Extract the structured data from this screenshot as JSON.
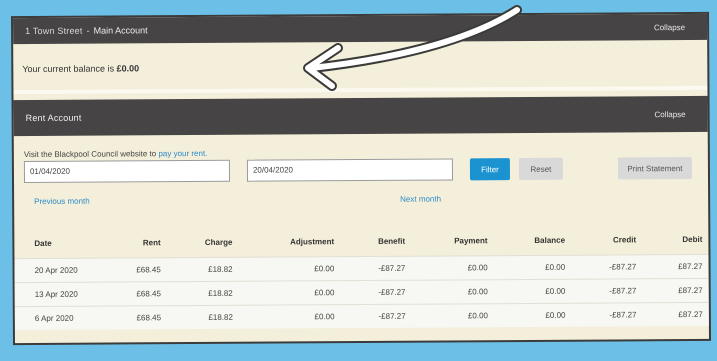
{
  "account": {
    "street": "1 Town Street",
    "separator": "-",
    "title": "Main Account",
    "collapse_label": "Collapse",
    "balance_prefix": "Your current balance is",
    "balance_value": "£0.00"
  },
  "rent": {
    "title": "Rent Account",
    "collapse_label": "Collapse",
    "visit_text": "Visit the Blackpool Council website to",
    "visit_link": "pay your rent.",
    "from_date": "01/04/2020",
    "to_date": "20/04/2020",
    "filter_label": "Filter",
    "reset_label": "Reset",
    "print_label": "Print Statement",
    "prev_label": "Previous month",
    "next_label": "Next month"
  },
  "table": {
    "headers": [
      "Date",
      "Rent",
      "Charge",
      "Adjustment",
      "Benefit",
      "Payment",
      "Balance",
      "Credit",
      "Debit"
    ],
    "rows": [
      [
        "20 Apr 2020",
        "£68.45",
        "£18.82",
        "£0.00",
        "-£87.27",
        "£0.00",
        "£0.00",
        "-£87.27",
        "£87.27"
      ],
      [
        "13 Apr 2020",
        "£68.45",
        "£18.82",
        "£0.00",
        "-£87.27",
        "£0.00",
        "£0.00",
        "-£87.27",
        "£87.27"
      ],
      [
        "6 Apr 2020",
        "£68.45",
        "£18.82",
        "£0.00",
        "-£87.27",
        "£0.00",
        "£0.00",
        "-£87.27",
        "£87.27"
      ]
    ]
  },
  "colors": {
    "background": "#6cc0e8",
    "header_bar": "#464444",
    "panel": "#f4efda",
    "link": "#2e8bc9",
    "filter_button": "#1b93d0",
    "arrow": "#ffffff"
  }
}
